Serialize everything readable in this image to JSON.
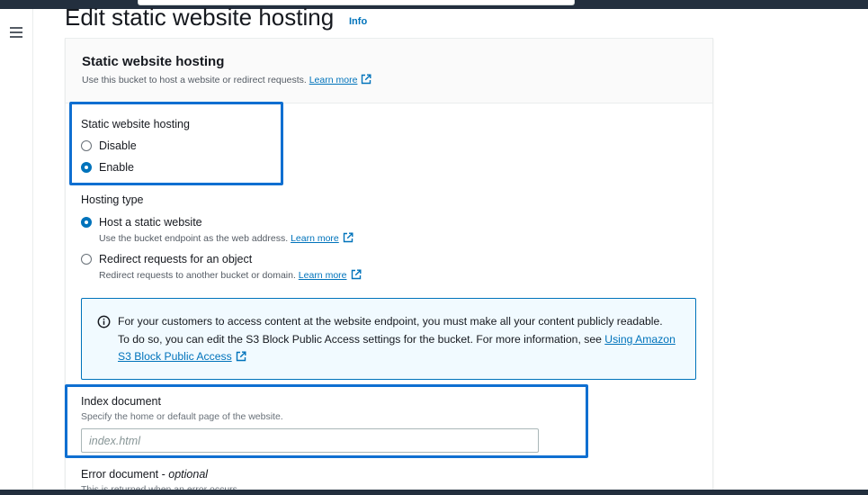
{
  "page": {
    "title": "Edit static website hosting",
    "info_label": "Info"
  },
  "section": {
    "title": "Static website hosting",
    "description": "Use this bucket to host a website or redirect requests.",
    "learn_more": "Learn more"
  },
  "hosting": {
    "label": "Static website hosting",
    "options": [
      {
        "label": "Disable",
        "checked": false
      },
      {
        "label": "Enable",
        "checked": true
      }
    ]
  },
  "hosting_type": {
    "label": "Hosting type",
    "options": [
      {
        "label": "Host a static website",
        "description": "Use the bucket endpoint as the web address.",
        "learn_more": "Learn more",
        "checked": true
      },
      {
        "label": "Redirect requests for an object",
        "description": "Redirect requests to another bucket or domain.",
        "learn_more": "Learn more",
        "checked": false
      }
    ]
  },
  "alert": {
    "text": "For your customers to access content at the website endpoint, you must make all your content publicly readable. To do so, you can edit the S3 Block Public Access settings for the bucket. For more information, see",
    "link": "Using Amazon S3 Block Public Access"
  },
  "index_document": {
    "label": "Index document",
    "description": "Specify the home or default page of the website.",
    "placeholder": "index.html",
    "value": ""
  },
  "error_document": {
    "label": "Error document - ",
    "label_suffix": "optional",
    "description": "This is returned when an error occurs."
  },
  "colors": {
    "link": "#0073bb",
    "highlight": "#0f6fd1",
    "alert_bg": "#f1faff",
    "nav_dark": "#232f3e"
  },
  "icons": [
    "menu-icon",
    "external-link-icon",
    "info-circle-icon"
  ]
}
